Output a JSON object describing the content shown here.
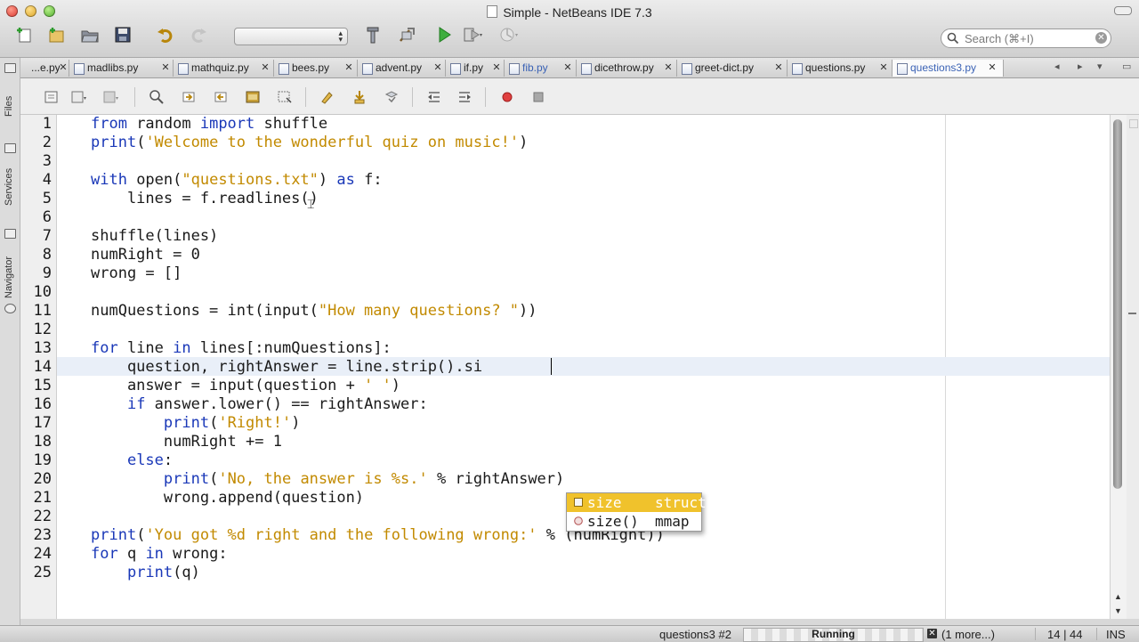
{
  "window": {
    "title": "Simple - NetBeans IDE 7.3"
  },
  "toolbar": {
    "icons": [
      "new-project-icon",
      "new-file-icon",
      "open-project-icon",
      "save-all-icon",
      "undo-icon",
      "redo-icon",
      "build-icon",
      "clean-build-icon",
      "run-icon",
      "debug-icon",
      "profile-icon"
    ],
    "search_placeholder": "Search (⌘+I)"
  },
  "side_panels": [
    "Files",
    "Services",
    "Navigator"
  ],
  "tabs": [
    {
      "label": "...e.py",
      "active": false,
      "modified": false
    },
    {
      "label": "madlibs.py",
      "active": false,
      "modified": false
    },
    {
      "label": "mathquiz.py",
      "active": false,
      "modified": false
    },
    {
      "label": "bees.py",
      "active": false,
      "modified": false
    },
    {
      "label": "advent.py",
      "active": false,
      "modified": false
    },
    {
      "label": "if.py",
      "active": false,
      "modified": false
    },
    {
      "label": "fib.py",
      "active": false,
      "modified": true
    },
    {
      "label": "dicethrow.py",
      "active": false,
      "modified": false
    },
    {
      "label": "greet-dict.py",
      "active": false,
      "modified": false
    },
    {
      "label": "questions.py",
      "active": false,
      "modified": false
    },
    {
      "label": "questions3.py",
      "active": true,
      "modified": true
    }
  ],
  "editor": {
    "current_line": 14,
    "lines": [
      [
        [
          "kw",
          "from"
        ],
        [
          "t",
          " random "
        ],
        [
          "kw",
          "import"
        ],
        [
          "t",
          " shuffle"
        ]
      ],
      [
        [
          "kw",
          "print"
        ],
        [
          "t",
          "("
        ],
        [
          "str",
          "'Welcome to the wonderful quiz on music!'"
        ],
        [
          "t",
          ")"
        ]
      ],
      [],
      [
        [
          "kw",
          "with"
        ],
        [
          "t",
          " open("
        ],
        [
          "str",
          "\"questions.txt\""
        ],
        [
          "t",
          ") "
        ],
        [
          "kw",
          "as"
        ],
        [
          "t",
          " f:"
        ]
      ],
      [
        [
          "t",
          "    lines = f.readlines()"
        ]
      ],
      [],
      [
        [
          "t",
          "shuffle(lines)"
        ]
      ],
      [
        [
          "t",
          "numRight = 0"
        ]
      ],
      [
        [
          "t",
          "wrong = []"
        ]
      ],
      [],
      [
        [
          "t",
          "numQuestions = int(input("
        ],
        [
          "str",
          "\"How many questions? \""
        ],
        [
          "t",
          "))"
        ]
      ],
      [],
      [
        [
          "kw",
          "for"
        ],
        [
          "t",
          " line "
        ],
        [
          "kw",
          "in"
        ],
        [
          "t",
          " lines[:numQuestions]:"
        ]
      ],
      [
        [
          "t",
          "    question, rightAnswer = line.strip().si"
        ]
      ],
      [
        [
          "t",
          "    answer = input(question + "
        ],
        [
          "str",
          "' '"
        ],
        [
          "t",
          ")"
        ]
      ],
      [
        [
          "t",
          "    "
        ],
        [
          "kw",
          "if"
        ],
        [
          "t",
          " answer.lower() == rightAnswer:"
        ]
      ],
      [
        [
          "t",
          "        "
        ],
        [
          "kw",
          "print"
        ],
        [
          "t",
          "("
        ],
        [
          "str",
          "'Right!'"
        ],
        [
          "t",
          ")"
        ]
      ],
      [
        [
          "t",
          "        numRight += 1"
        ]
      ],
      [
        [
          "t",
          "    "
        ],
        [
          "kw",
          "else"
        ],
        [
          "t",
          ":"
        ]
      ],
      [
        [
          "t",
          "        "
        ],
        [
          "kw",
          "print"
        ],
        [
          "t",
          "("
        ],
        [
          "str",
          "'No, the answer is %s.'"
        ],
        [
          "t",
          " % rightAnswer)"
        ]
      ],
      [
        [
          "t",
          "        wrong.append(question)"
        ]
      ],
      [],
      [
        [
          "kw",
          "print"
        ],
        [
          "t",
          "("
        ],
        [
          "str",
          "'You got %d right and the following wrong:'"
        ],
        [
          "t",
          " % (numRight))"
        ]
      ],
      [
        [
          "kw",
          "for"
        ],
        [
          "t",
          " q "
        ],
        [
          "kw",
          "in"
        ],
        [
          "t",
          " wrong:"
        ]
      ],
      [
        [
          "t",
          "    "
        ],
        [
          "kw",
          "print"
        ],
        [
          "t",
          "(q)"
        ]
      ]
    ]
  },
  "completion": {
    "items": [
      {
        "name": "size",
        "type": "struct",
        "selected": true
      },
      {
        "name": "size()",
        "type": "mmap",
        "selected": false
      }
    ]
  },
  "status": {
    "task": "questions3 #2",
    "progress_label": "Running",
    "more": "(1 more...)",
    "position": "14 | 44",
    "mode": "INS"
  },
  "colors": {
    "keyword": "#1a38b8",
    "string": "#c28a00",
    "completion_selected": "#f0c22c",
    "current_line": "#e9eff8"
  }
}
